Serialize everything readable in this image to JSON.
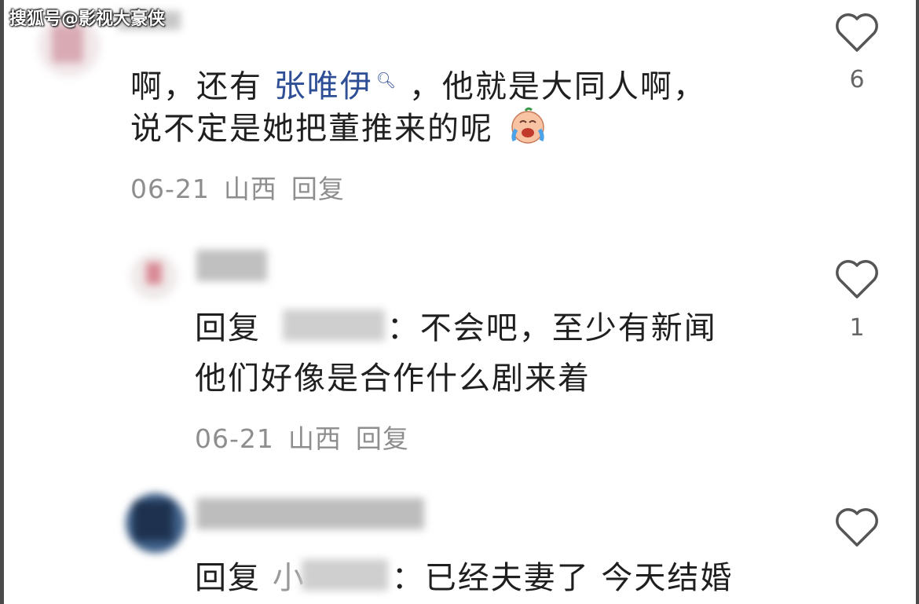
{
  "watermark": "搜狐号@影视大豪侠",
  "comments": [
    {
      "line1_prefix": "啊，还有",
      "mention": "张唯伊",
      "line1_suffix": "，他就是大同人啊，",
      "line2": "说不定是她把董推来的呢",
      "emoji": "crying-laugh-emoji",
      "date": "06-21",
      "location": "山西",
      "reply_action": "回复",
      "likes": "6"
    },
    {
      "reply_word": "回复",
      "colon": "：",
      "line1": "不会吧，至少有新闻",
      "line2": "他们好像是合作什么剧来着",
      "date": "06-21",
      "location": "山西",
      "reply_action": "回复",
      "likes": "1"
    },
    {
      "reply_word": "回复",
      "mention_visible": "小",
      "colon": "：",
      "line1": "已经夫妻了 今天结婚",
      "likes": ""
    }
  ],
  "colors": {
    "mention": "#2e4f96",
    "meta": "#8e8e8e",
    "text": "#1f1f1f"
  },
  "icons": [
    "heart-outline-icon",
    "search-icon"
  ]
}
